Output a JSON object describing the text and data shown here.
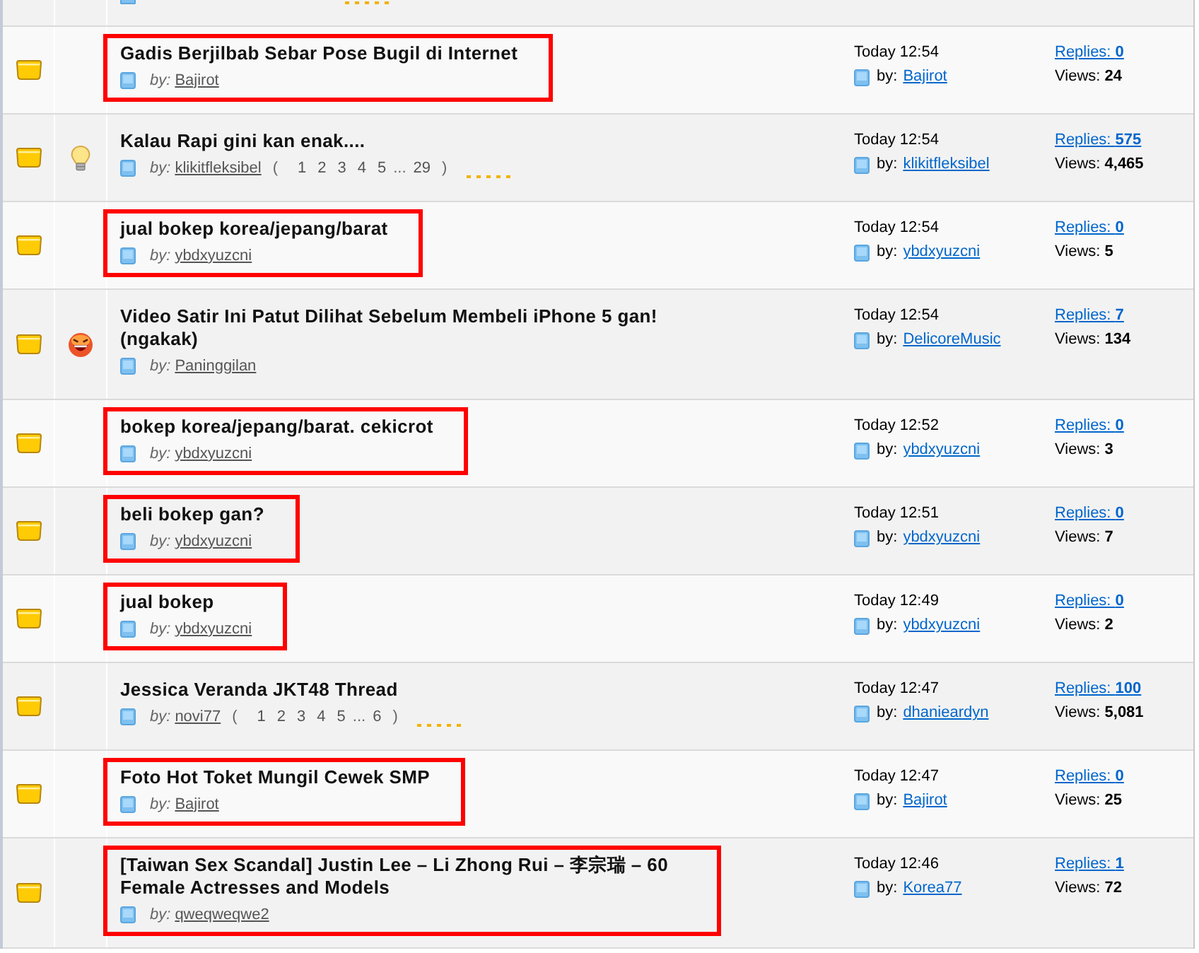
{
  "partial_row": {
    "stars": 5
  },
  "threads": [
    {
      "title": "Gadis Berjilbab Sebar Pose Bugil di Internet",
      "highlighted": true,
      "author_label": "by:",
      "author": "Bajirot",
      "last_post_time": "Today 12:54",
      "last_post_label": "by:",
      "last_poster": "Bajirot",
      "replies_label": "Replies:",
      "replies": "0",
      "views_label": "Views:",
      "views": "24"
    },
    {
      "title": "Kalau Rapi gini kan enak....",
      "highlighted": false,
      "post_icon": {
        "kind": "bulb"
      },
      "author_label": "by:",
      "author": "klikitfleksibel",
      "pagination": {
        "open": "(",
        "pages": [
          "1",
          "2",
          "3",
          "4",
          "5"
        ],
        "gap": "...",
        "last_page": "29",
        "close": ")"
      },
      "stars": 5,
      "last_post_time": "Today 12:54",
      "last_post_label": "by:",
      "last_poster": "klikitfleksibel",
      "replies_label": "Replies:",
      "replies": "575",
      "views_label": "Views:",
      "views": "4,465"
    },
    {
      "title": "jual bokep korea/jepang/barat",
      "highlighted": true,
      "author_label": "by:",
      "author": "ybdxyuzcni",
      "last_post_time": "Today 12:54",
      "last_post_label": "by:",
      "last_poster": "ybdxyuzcni",
      "replies_label": "Replies:",
      "replies": "0",
      "views_label": "Views:",
      "views": "5"
    },
    {
      "title": "Video Satir Ini Patut Dilihat Sebelum Membeli iPhone 5 gan! (ngakak)",
      "highlighted": false,
      "post_icon": {
        "kind": "laugh"
      },
      "author_label": "by:",
      "author": "Paninggilan",
      "last_post_time": "Today 12:54",
      "last_post_label": "by:",
      "last_poster": "DelicoreMusic",
      "replies_label": "Replies:",
      "replies": "7",
      "views_label": "Views:",
      "views": "134"
    },
    {
      "title": "bokep korea/jepang/barat. cekicrot",
      "highlighted": true,
      "author_label": "by:",
      "author": "ybdxyuzcni",
      "last_post_time": "Today 12:52",
      "last_post_label": "by:",
      "last_poster": "ybdxyuzcni",
      "replies_label": "Replies:",
      "replies": "0",
      "views_label": "Views:",
      "views": "3"
    },
    {
      "title": "beli bokep gan?",
      "highlighted": true,
      "author_label": "by:",
      "author": "ybdxyuzcni",
      "last_post_time": "Today 12:51",
      "last_post_label": "by:",
      "last_poster": "ybdxyuzcni",
      "replies_label": "Replies:",
      "replies": "0",
      "views_label": "Views:",
      "views": "7"
    },
    {
      "title": "jual bokep",
      "highlighted": true,
      "author_label": "by:",
      "author": "ybdxyuzcni",
      "last_post_time": "Today 12:49",
      "last_post_label": "by:",
      "last_poster": "ybdxyuzcni",
      "replies_label": "Replies:",
      "replies": "0",
      "views_label": "Views:",
      "views": "2"
    },
    {
      "title": "Jessica Veranda JKT48 Thread",
      "highlighted": false,
      "author_label": "by:",
      "author": "novi77",
      "pagination": {
        "open": "(",
        "pages": [
          "1",
          "2",
          "3",
          "4",
          "5"
        ],
        "gap": "...",
        "last_page": "6",
        "close": ")"
      },
      "stars": 5,
      "last_post_time": "Today 12:47",
      "last_post_label": "by:",
      "last_poster": "dhanieardyn",
      "replies_label": "Replies:",
      "replies": "100",
      "views_label": "Views:",
      "views": "5,081"
    },
    {
      "title": "Foto Hot Toket Mungil Cewek SMP",
      "highlighted": true,
      "author_label": "by:",
      "author": "Bajirot",
      "last_post_time": "Today 12:47",
      "last_post_label": "by:",
      "last_poster": "Bajirot",
      "replies_label": "Replies:",
      "replies": "0",
      "views_label": "Views:",
      "views": "25"
    },
    {
      "title": "[Taiwan Sex Scandal] Justin Lee – Li Zhong Rui – 李宗瑞 – 60 Female Actresses and Models",
      "highlighted": true,
      "author_label": "by:",
      "author": "qweqweqwe2",
      "last_post_time": "Today 12:46",
      "last_post_label": "by:",
      "last_poster": "Korea77",
      "replies_label": "Replies:",
      "replies": "1",
      "views_label": "Views:",
      "views": "72"
    }
  ]
}
